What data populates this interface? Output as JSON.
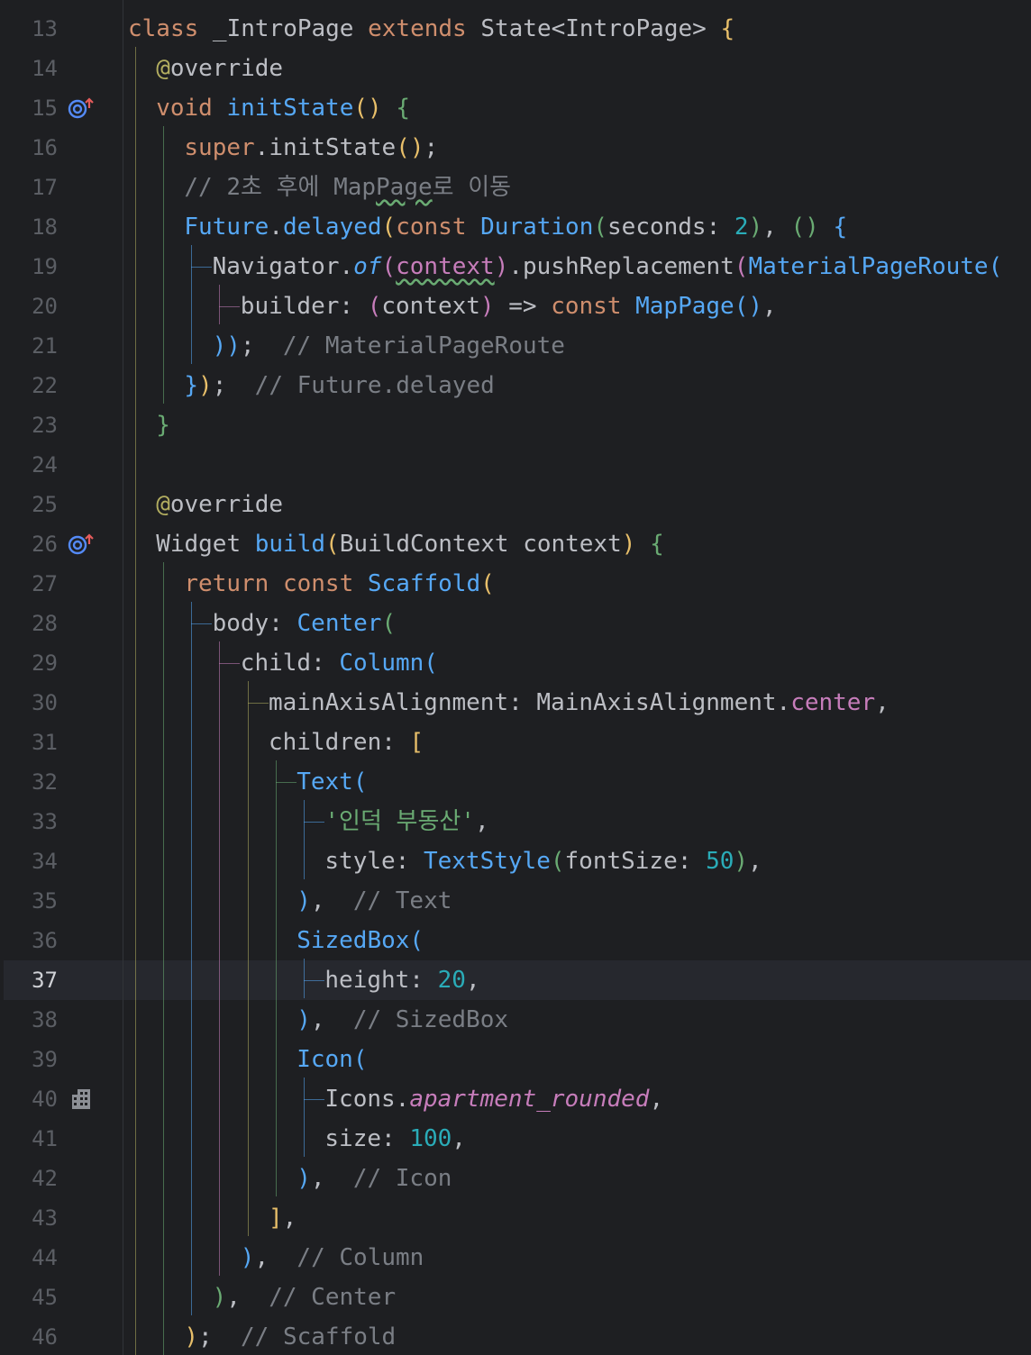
{
  "editor": {
    "language": "Dart",
    "current_line": 37,
    "colors": {
      "background": "#1e1f22",
      "keyword": "#cf8e6d",
      "function": "#56a8f5",
      "annotation": "#b3ae60",
      "number": "#2aacb8",
      "string": "#6aab73",
      "comment": "#7a7e85",
      "field": "#c77dbb",
      "plain": "#bcbec4"
    },
    "lines": [
      {
        "n": "13",
        "indent": 0,
        "tokens": [
          [
            "class ",
            "kw"
          ],
          [
            "_IntroPage ",
            "plain"
          ],
          [
            "extends ",
            "kw"
          ],
          [
            "State<IntroPage> ",
            "plain"
          ],
          [
            "{",
            "b1"
          ]
        ]
      },
      {
        "n": "14",
        "indent": 1,
        "tokens": [
          [
            "@",
            "anno"
          ],
          [
            "override",
            "plain"
          ]
        ]
      },
      {
        "n": "15",
        "indent": 1,
        "icon": "override-method-icon",
        "tokens": [
          [
            "void ",
            "kw"
          ],
          [
            "initState",
            "fn"
          ],
          [
            "() ",
            "b1"
          ],
          [
            "{",
            "b4"
          ]
        ]
      },
      {
        "n": "16",
        "indent": 2,
        "tokens": [
          [
            "super",
            "kw"
          ],
          [
            ".initState",
            "plain"
          ],
          [
            "()",
            "b1"
          ],
          [
            ";",
            "plain"
          ]
        ]
      },
      {
        "n": "17",
        "indent": 2,
        "tokens": [
          [
            "// 2초 후에 Map",
            "cmt"
          ],
          [
            "Page",
            "cmt wavy"
          ],
          [
            "로 이동",
            "cmt"
          ]
        ]
      },
      {
        "n": "18",
        "indent": 2,
        "tokens": [
          [
            "Future",
            "fn"
          ],
          [
            ".",
            "plain"
          ],
          [
            "delayed",
            "fn"
          ],
          [
            "(",
            "b1"
          ],
          [
            "const ",
            "kw"
          ],
          [
            "Duration",
            "fn"
          ],
          [
            "(",
            "b4"
          ],
          [
            "seconds: ",
            "plain"
          ],
          [
            "2",
            "num"
          ],
          [
            ")",
            "b4"
          ],
          [
            ", ",
            "plain"
          ],
          [
            "() ",
            "b4"
          ],
          [
            "{",
            "b3"
          ]
        ]
      },
      {
        "n": "19",
        "indent": 3,
        "tokens": [
          [
            "Navigator",
            "plain"
          ],
          [
            ".",
            "plain"
          ],
          [
            "of",
            "fn italic"
          ],
          [
            "(",
            "b2"
          ],
          [
            "context",
            "b2 wavy"
          ],
          [
            ")",
            "b2"
          ],
          [
            ".pushReplacement",
            "plain"
          ],
          [
            "(",
            "b2"
          ],
          [
            "MaterialPageRoute",
            "fn"
          ],
          [
            "(",
            "b3"
          ]
        ]
      },
      {
        "n": "20",
        "indent": 4,
        "tokens": [
          [
            "builder: ",
            "plain"
          ],
          [
            "(",
            "b2"
          ],
          [
            "context",
            "plain"
          ],
          [
            ") ",
            "b2"
          ],
          [
            "=> ",
            "plain"
          ],
          [
            "const ",
            "kw"
          ],
          [
            "MapPage",
            "fn"
          ],
          [
            "()",
            "b3"
          ],
          [
            ",",
            "plain"
          ]
        ]
      },
      {
        "n": "21",
        "indent": 3,
        "tokens": [
          [
            "))",
            "b3"
          ],
          [
            ";  ",
            "plain"
          ],
          [
            "// MaterialPageRoute",
            "cmt"
          ]
        ]
      },
      {
        "n": "22",
        "indent": 2,
        "tokens": [
          [
            "}",
            "b3"
          ],
          [
            ")",
            "b1"
          ],
          [
            ";  ",
            "plain"
          ],
          [
            "// Future.delayed",
            "cmt"
          ]
        ]
      },
      {
        "n": "23",
        "indent": 1,
        "tokens": [
          [
            "}",
            "b4"
          ]
        ]
      },
      {
        "n": "24",
        "indent": 0,
        "tokens": []
      },
      {
        "n": "25",
        "indent": 1,
        "tokens": [
          [
            "@",
            "anno"
          ],
          [
            "override",
            "plain"
          ]
        ]
      },
      {
        "n": "26",
        "indent": 1,
        "icon": "override-method-icon",
        "tokens": [
          [
            "Widget ",
            "plain"
          ],
          [
            "build",
            "fn"
          ],
          [
            "(",
            "b1"
          ],
          [
            "BuildContext context",
            "plain"
          ],
          [
            ") ",
            "b1"
          ],
          [
            "{",
            "b4"
          ]
        ]
      },
      {
        "n": "27",
        "indent": 2,
        "tokens": [
          [
            "return ",
            "kw"
          ],
          [
            "const ",
            "kw"
          ],
          [
            "Scaffold",
            "fn"
          ],
          [
            "(",
            "b1"
          ]
        ]
      },
      {
        "n": "28",
        "indent": 3,
        "tokens": [
          [
            "body: ",
            "plain"
          ],
          [
            "Center",
            "fn"
          ],
          [
            "(",
            "b4"
          ]
        ]
      },
      {
        "n": "29",
        "indent": 4,
        "tokens": [
          [
            "child: ",
            "plain"
          ],
          [
            "Column",
            "fn"
          ],
          [
            "(",
            "b3"
          ]
        ]
      },
      {
        "n": "30",
        "indent": 5,
        "tokens": [
          [
            "mainAxisAlignment: ",
            "plain"
          ],
          [
            "MainAxisAlignment",
            "plain"
          ],
          [
            ".",
            "plain"
          ],
          [
            "center",
            "field"
          ],
          [
            ",",
            "plain"
          ]
        ]
      },
      {
        "n": "31",
        "indent": 5,
        "tokens": [
          [
            "children: ",
            "plain"
          ],
          [
            "[",
            "b1"
          ]
        ]
      },
      {
        "n": "32",
        "indent": 6,
        "tokens": [
          [
            "Text",
            "fn"
          ],
          [
            "(",
            "b3"
          ]
        ]
      },
      {
        "n": "33",
        "indent": 7,
        "tokens": [
          [
            "'인덕 부동산'",
            "str"
          ],
          [
            ",",
            "plain"
          ]
        ]
      },
      {
        "n": "34",
        "indent": 7,
        "tokens": [
          [
            "style: ",
            "plain"
          ],
          [
            "TextStyle",
            "fn"
          ],
          [
            "(",
            "b4"
          ],
          [
            "fontSize: ",
            "plain"
          ],
          [
            "50",
            "num"
          ],
          [
            ")",
            "b4"
          ],
          [
            ",",
            "plain"
          ]
        ]
      },
      {
        "n": "35",
        "indent": 6,
        "tokens": [
          [
            ")",
            "b3"
          ],
          [
            ",  ",
            "plain"
          ],
          [
            "// Text",
            "cmt"
          ]
        ]
      },
      {
        "n": "36",
        "indent": 6,
        "tokens": [
          [
            "SizedBox",
            "fn"
          ],
          [
            "(",
            "b3"
          ]
        ]
      },
      {
        "n": "37",
        "indent": 7,
        "tokens": [
          [
            "height: ",
            "plain"
          ],
          [
            "20",
            "num"
          ],
          [
            ",",
            "plain"
          ]
        ]
      },
      {
        "n": "38",
        "indent": 6,
        "tokens": [
          [
            ")",
            "b3"
          ],
          [
            ",  ",
            "plain"
          ],
          [
            "// SizedBox",
            "cmt"
          ]
        ]
      },
      {
        "n": "39",
        "indent": 6,
        "tokens": [
          [
            "Icon",
            "fn"
          ],
          [
            "(",
            "b3"
          ]
        ]
      },
      {
        "n": "40",
        "indent": 7,
        "icon": "apartment-icon",
        "tokens": [
          [
            "Icons",
            "plain"
          ],
          [
            ".",
            "plain"
          ],
          [
            "apartment_rounded",
            "field italic"
          ],
          [
            ",",
            "plain"
          ]
        ]
      },
      {
        "n": "41",
        "indent": 7,
        "tokens": [
          [
            "size: ",
            "plain"
          ],
          [
            "100",
            "num"
          ],
          [
            ",",
            "plain"
          ]
        ]
      },
      {
        "n": "42",
        "indent": 6,
        "tokens": [
          [
            ")",
            "b3"
          ],
          [
            ",  ",
            "plain"
          ],
          [
            "// Icon",
            "cmt"
          ]
        ]
      },
      {
        "n": "43",
        "indent": 5,
        "tokens": [
          [
            "]",
            "b1"
          ],
          [
            ",",
            "plain"
          ]
        ]
      },
      {
        "n": "44",
        "indent": 4,
        "tokens": [
          [
            ")",
            "b3"
          ],
          [
            ",  ",
            "plain"
          ],
          [
            "// Column",
            "cmt"
          ]
        ]
      },
      {
        "n": "45",
        "indent": 3,
        "tokens": [
          [
            ")",
            "b4"
          ],
          [
            ",  ",
            "plain"
          ],
          [
            "// Center",
            "cmt"
          ]
        ]
      },
      {
        "n": "46",
        "indent": 2,
        "tokens": [
          [
            ")",
            "b1"
          ],
          [
            ";  ",
            "plain"
          ],
          [
            "// Scaffold",
            "cmt"
          ]
        ]
      }
    ]
  }
}
